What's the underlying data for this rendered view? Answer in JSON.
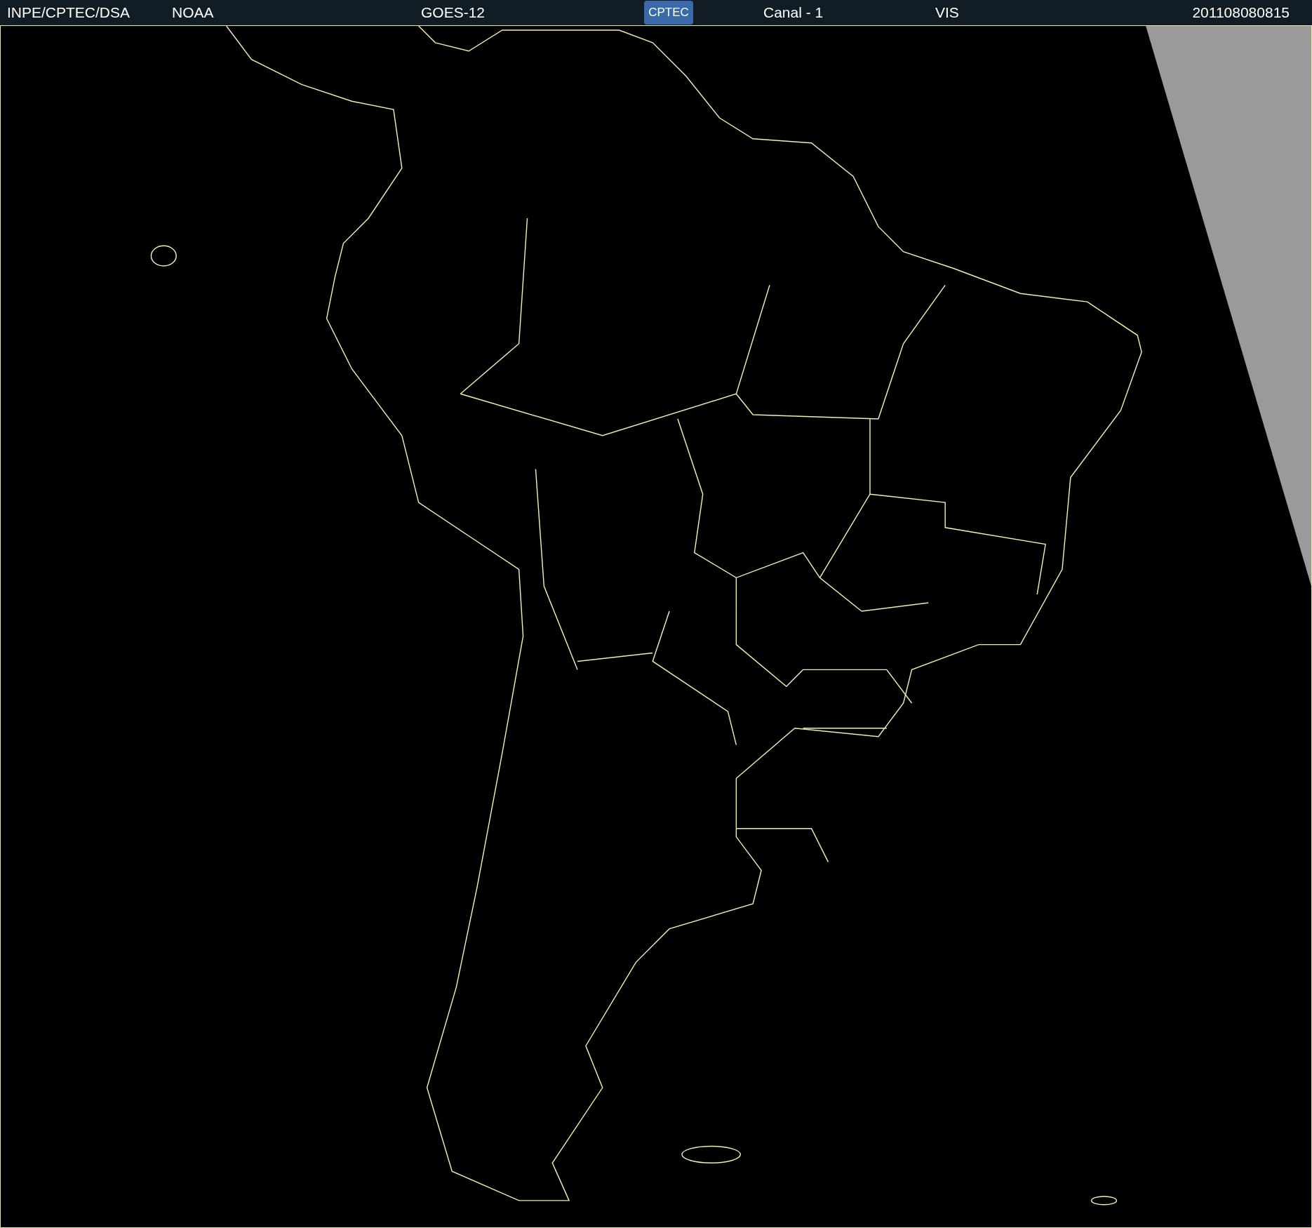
{
  "header": {
    "source": "INPE/CPTEC/DSA",
    "agency": "NOAA",
    "satellite": "GOES-12",
    "logo": "CPTEC",
    "channel": "Canal - 1",
    "band": "VIS",
    "timestamp": "201108080815"
  }
}
